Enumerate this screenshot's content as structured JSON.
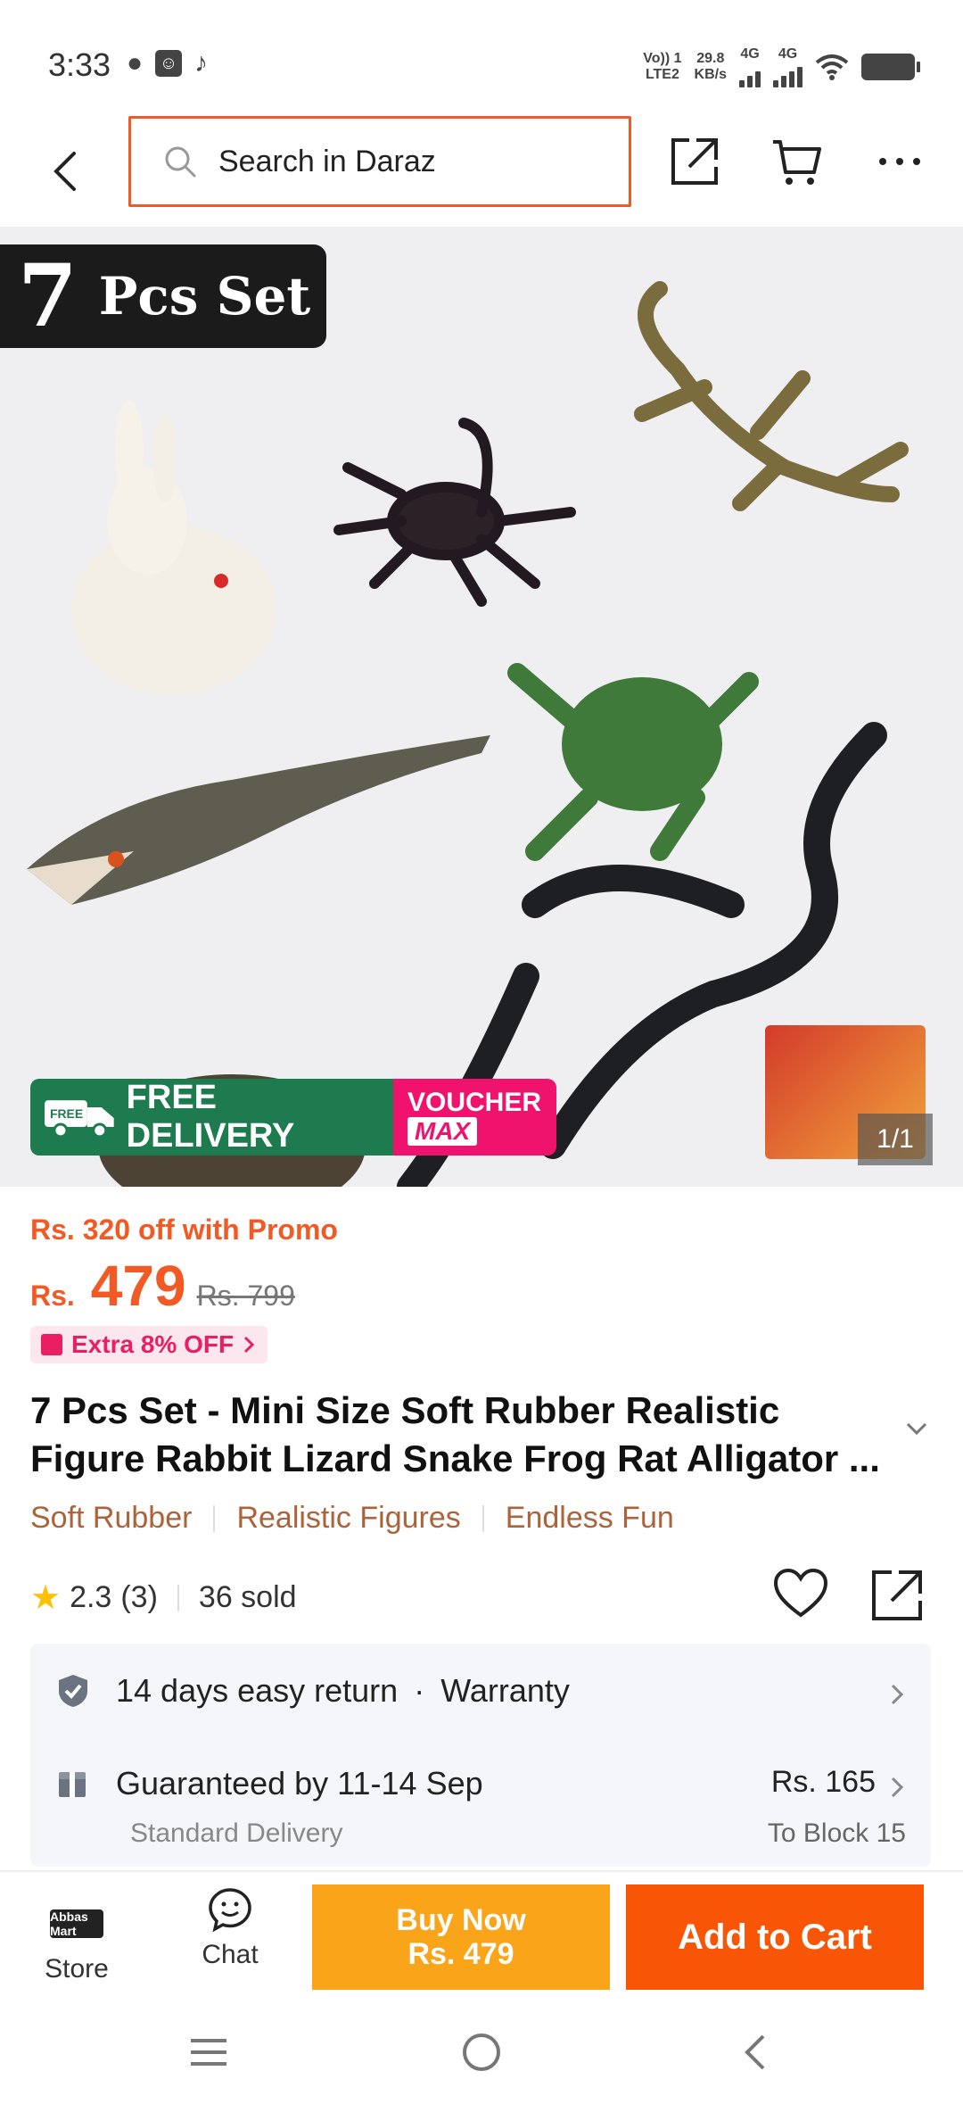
{
  "status_bar": {
    "time": "3:33",
    "net_line1": "Vo)) 1",
    "net_line2": "LTE2",
    "speed_value": "29.8",
    "speed_unit": "KB/s",
    "sim1": "4G",
    "sim2": "4G"
  },
  "header": {
    "search_placeholder": "Search in Daraz"
  },
  "product_image": {
    "badge_number": "7",
    "badge_text": "Pcs Set",
    "free_delivery_label": "FREE DELIVERY",
    "free_word": "FREE",
    "voucher_line1": "VOUCHER",
    "voucher_line2": "MAX",
    "page_counter": "1/1"
  },
  "pricing": {
    "promo_text": "Rs. 320 off with Promo",
    "currency": "Rs.",
    "price": "479",
    "original_price": "Rs. 799",
    "extra_off": "Extra 8% OFF"
  },
  "product": {
    "title": "7 Pcs Set - Mini Size Soft Rubber Realistic Figure Rabbit Lizard Snake Frog Rat Alligator ...",
    "tags": [
      "Soft Rubber",
      "Realistic Figures",
      "Endless Fun"
    ],
    "rating": "2.3",
    "rating_count": "(3)",
    "sold": "36 sold"
  },
  "services": {
    "return_text": "14 days easy return",
    "warranty_text": "Warranty",
    "delivery_text": "Guaranteed by 11-14 Sep",
    "delivery_fee": "Rs. 165",
    "delivery_type": "Standard Delivery",
    "destination": "To Block 15"
  },
  "bottom_bar": {
    "store_logo": "Abbas Mart",
    "store_label": "Store",
    "chat_label": "Chat",
    "buy_now_line1": "Buy Now",
    "buy_now_line2": "Rs. 479",
    "add_to_cart": "Add to Cart"
  },
  "colors": {
    "brand_orange": "#f85606",
    "buy_now_yellow": "#faa419",
    "promo_orange": "#f15a24",
    "voucher_pink": "#f0136e",
    "free_delivery_green": "#1e7a4f"
  }
}
